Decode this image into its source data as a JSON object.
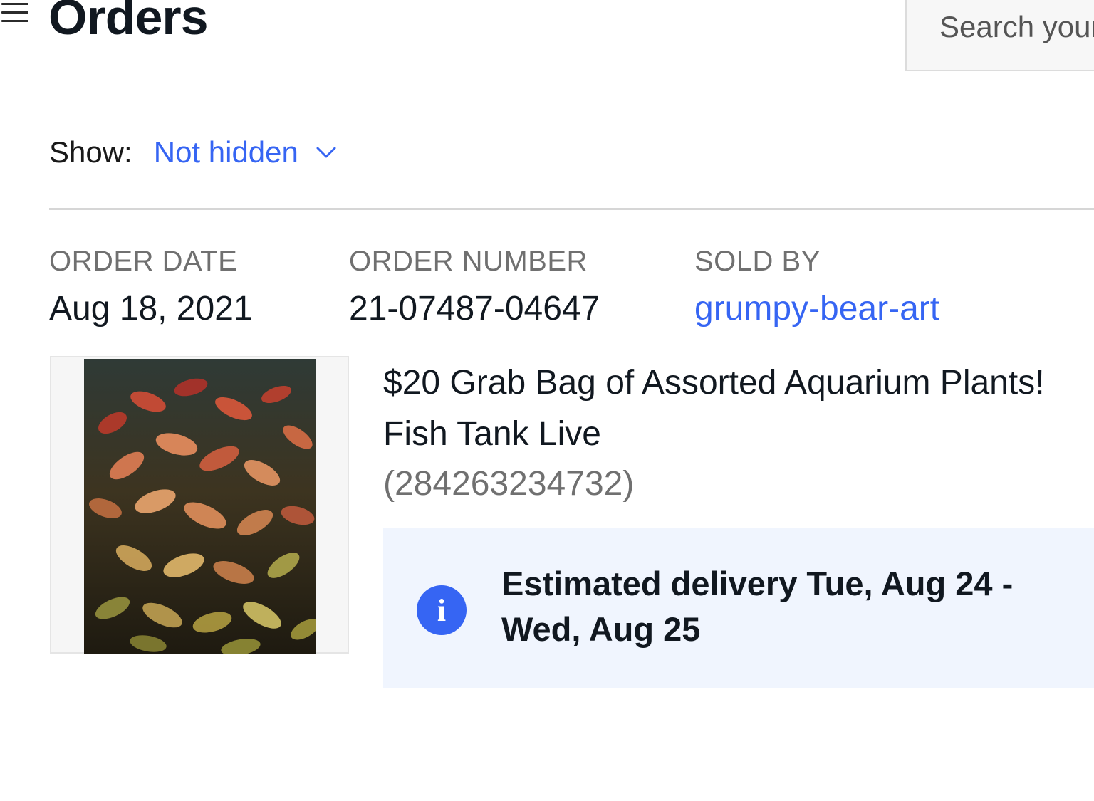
{
  "header": {
    "title": "Orders",
    "menu_icon": "hamburger-menu-icon",
    "search": {
      "placeholder": "Search your orders",
      "value": ""
    }
  },
  "filter": {
    "label": "Show:",
    "selected": "Not hidden",
    "icon": "chevron-down-icon"
  },
  "order": {
    "date_label": "ORDER DATE",
    "date": "Aug 18, 2021",
    "number_label": "ORDER NUMBER",
    "number": "21-07487-04647",
    "seller_label": "SOLD BY",
    "seller": "grumpy-bear-art",
    "item": {
      "title": "$20 Grab Bag of Assorted Aquarium Plants! Fish Tank Live",
      "item_number": "(284263234732)"
    },
    "delivery": {
      "icon": "info-icon",
      "icon_glyph": "i",
      "text": "Estimated delivery Tue, Aug 24 - Wed, Aug 25"
    }
  },
  "colors": {
    "link": "#3665f3",
    "info_bg": "#f0f5fe",
    "muted": "#707070"
  }
}
